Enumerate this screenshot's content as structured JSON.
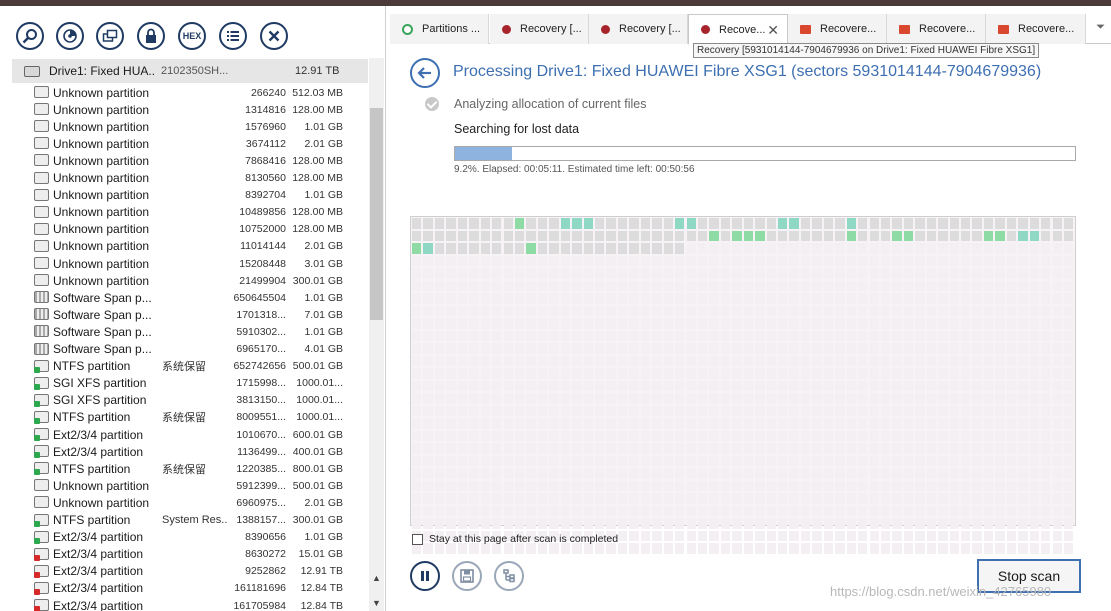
{
  "toolbar": {
    "buttons": [
      {
        "name": "search-button",
        "icon": "magnifier-icon"
      },
      {
        "name": "scan-disk-button",
        "icon": "disk-scan-icon"
      },
      {
        "name": "image-disk-button",
        "icon": "disk-image-icon"
      },
      {
        "name": "lock-button",
        "icon": "lock-icon"
      },
      {
        "name": "hex-view-button",
        "icon": "hex-icon",
        "label": "HEX"
      },
      {
        "name": "list-view-button",
        "icon": "list-icon"
      },
      {
        "name": "close-button",
        "icon": "close-icon"
      }
    ]
  },
  "drive": {
    "name": "Drive1: Fixed HUA...",
    "serial": "2102350SH...",
    "size": "12.91 TB"
  },
  "partitions": [
    {
      "name": "Unknown partition",
      "label": "",
      "start": "266240",
      "size": "512.03 MB",
      "kind": "unknown"
    },
    {
      "name": "Unknown partition",
      "label": "",
      "start": "1314816",
      "size": "128.00 MB",
      "kind": "unknown"
    },
    {
      "name": "Unknown partition",
      "label": "",
      "start": "1576960",
      "size": "1.01 GB",
      "kind": "unknown"
    },
    {
      "name": "Unknown partition",
      "label": "",
      "start": "3674112",
      "size": "2.01 GB",
      "kind": "unknown"
    },
    {
      "name": "Unknown partition",
      "label": "",
      "start": "7868416",
      "size": "128.00 MB",
      "kind": "unknown"
    },
    {
      "name": "Unknown partition",
      "label": "",
      "start": "8130560",
      "size": "128.00 MB",
      "kind": "unknown"
    },
    {
      "name": "Unknown partition",
      "label": "",
      "start": "8392704",
      "size": "1.01 GB",
      "kind": "unknown"
    },
    {
      "name": "Unknown partition",
      "label": "",
      "start": "10489856",
      "size": "128.00 MB",
      "kind": "unknown"
    },
    {
      "name": "Unknown partition",
      "label": "",
      "start": "10752000",
      "size": "128.00 MB",
      "kind": "unknown"
    },
    {
      "name": "Unknown partition",
      "label": "",
      "start": "11014144",
      "size": "2.01 GB",
      "kind": "unknown"
    },
    {
      "name": "Unknown partition",
      "label": "",
      "start": "15208448",
      "size": "3.01 GB",
      "kind": "unknown"
    },
    {
      "name": "Unknown partition",
      "label": "",
      "start": "21499904",
      "size": "300.01 GB",
      "kind": "unknown"
    },
    {
      "name": "Software Span p...",
      "label": "",
      "start": "650645504",
      "size": "1.01 GB",
      "kind": "span"
    },
    {
      "name": "Software Span p...",
      "label": "",
      "start": "1701318...",
      "size": "7.01 GB",
      "kind": "span"
    },
    {
      "name": "Software Span p...",
      "label": "",
      "start": "5910302...",
      "size": "1.01 GB",
      "kind": "span"
    },
    {
      "name": "Software Span p...",
      "label": "",
      "start": "6965170...",
      "size": "4.01 GB",
      "kind": "span"
    },
    {
      "name": "NTFS partition",
      "label": "系统保留",
      "start": "652742656",
      "size": "500.01 GB",
      "kind": "green"
    },
    {
      "name": "SGI XFS partition",
      "label": "",
      "start": "1715998...",
      "size": "1000.01...",
      "kind": "green"
    },
    {
      "name": "SGI XFS partition",
      "label": "",
      "start": "3813150...",
      "size": "1000.01...",
      "kind": "green"
    },
    {
      "name": "NTFS partition",
      "label": "系统保留",
      "start": "8009551...",
      "size": "1000.01...",
      "kind": "green"
    },
    {
      "name": "Ext2/3/4 partition",
      "label": "",
      "start": "1010670...",
      "size": "600.01 GB",
      "kind": "green"
    },
    {
      "name": "Ext2/3/4 partition",
      "label": "",
      "start": "1136499...",
      "size": "400.01 GB",
      "kind": "green"
    },
    {
      "name": "NTFS partition",
      "label": "系统保留",
      "start": "1220385...",
      "size": "800.01 GB",
      "kind": "green"
    },
    {
      "name": "Unknown partition",
      "label": "",
      "start": "5912399...",
      "size": "500.01 GB",
      "kind": "unknown"
    },
    {
      "name": "Unknown partition",
      "label": "",
      "start": "6960975...",
      "size": "2.01 GB",
      "kind": "unknown"
    },
    {
      "name": "NTFS partition",
      "label": "System Res...",
      "start": "1388157...",
      "size": "300.01 GB",
      "kind": "green"
    },
    {
      "name": "Ext2/3/4 partition",
      "label": "",
      "start": "8390656",
      "size": "1.01 GB",
      "kind": "green"
    },
    {
      "name": "Ext2/3/4 partition",
      "label": "",
      "start": "8630272",
      "size": "15.01 GB",
      "kind": "red"
    },
    {
      "name": "Ext2/3/4 partition",
      "label": "",
      "start": "9252862",
      "size": "12.91 TB",
      "kind": "red"
    },
    {
      "name": "Ext2/3/4 partition",
      "label": "",
      "start": "161181696",
      "size": "12.84 TB",
      "kind": "red"
    },
    {
      "name": "Ext2/3/4 partition",
      "label": "",
      "start": "161705984",
      "size": "12.84 TB",
      "kind": "red"
    }
  ],
  "tabs": [
    {
      "label": "Partitions ...",
      "icon": "ring",
      "color": "#3aa55a",
      "active": false
    },
    {
      "label": "Recovery [...",
      "icon": "dot",
      "color": "#a8242b",
      "active": false
    },
    {
      "label": "Recovery [...",
      "icon": "dot",
      "color": "#a8242b",
      "active": false
    },
    {
      "label": "Recove...",
      "icon": "dot",
      "color": "#a8242b",
      "active": true
    },
    {
      "label": "Recovere...",
      "icon": "folder",
      "color": "#d9472f",
      "active": false
    },
    {
      "label": "Recovere...",
      "icon": "folder",
      "color": "#d9472f",
      "active": false
    },
    {
      "label": "Recovere...",
      "icon": "folder",
      "color": "#d9472f",
      "active": false
    }
  ],
  "tooltip": "Recovery [5931014144-7904679936 on Drive1: Fixed HUAWEI Fibre XSG1]",
  "process": {
    "title": "Processing Drive1: Fixed HUAWEI Fibre XSG1 (sectors 5931014144-7904679936)",
    "step_done": "Analyzing allocation of current files",
    "step_current": "Searching for lost data",
    "progress_percent": 9.2,
    "progress_text": "9.2%. Elapsed: 00:05:11. Estimated time left: 00:50:56"
  },
  "map": {
    "columns": 58,
    "rows": 27,
    "scanned_cells": 140,
    "green_cells": [
      9,
      84,
      86,
      87,
      88,
      96,
      100,
      101,
      108,
      109,
      116,
      126,
      191
    ],
    "teal_cells": [
      13,
      14,
      15,
      23,
      24,
      32,
      33,
      38,
      111,
      112,
      117,
      126,
      167,
      179
    ]
  },
  "stay_checkbox": {
    "label": "Stay at this page after scan is completed",
    "checked": false
  },
  "actions": {
    "pause_icon": "pause-icon",
    "save_icon": "save-icon",
    "tree_icon": "tree-icon",
    "stop_label": "Stop scan"
  },
  "watermark": "https://blog.csdn.net/weixin_42765980",
  "colors": {
    "accent": "#3d6fb1",
    "dark_accent": "#1f3a63",
    "red_tab": "#a8242b",
    "green": "#3aa55a",
    "progress_fill": "#8eb3df"
  }
}
